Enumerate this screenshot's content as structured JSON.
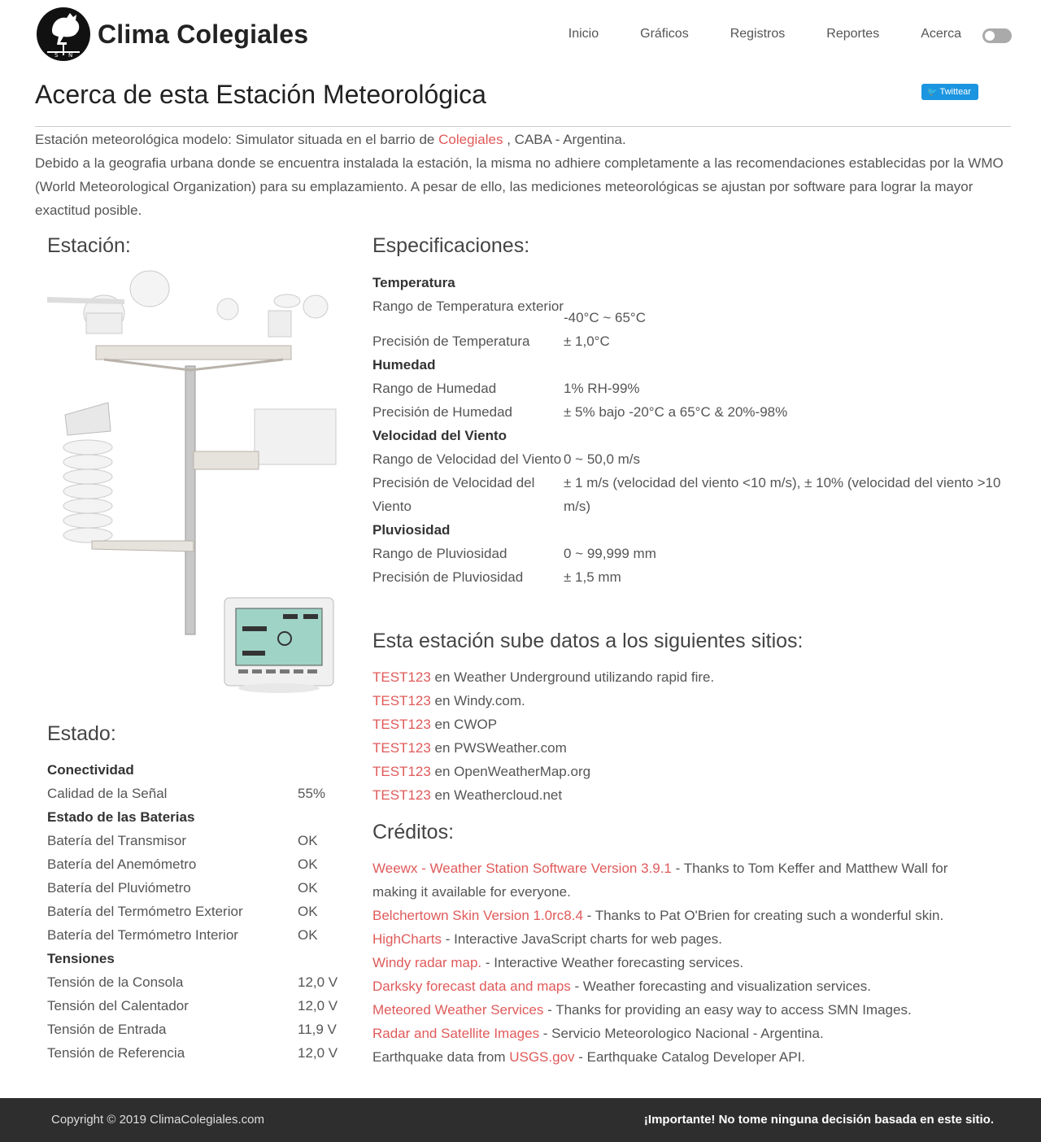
{
  "header": {
    "brand": "Clima Colegiales",
    "nav": [
      "Inicio",
      "Gráficos",
      "Registros",
      "Reportes",
      "Acerca"
    ]
  },
  "page": {
    "title": "Acerca de esta Estación Meteorológica",
    "tweet_label": "Twittear",
    "intro_a": "Estación meteorológica modelo: Simulator situada en el barrio de ",
    "intro_link": "Colegiales",
    "intro_b": " , CABA - Argentina.",
    "intro_c": "Debido a la geografia urbana donde se encuentra instalada la estación, la misma no adhiere completamente a las recomendaciones establecidas por la WMO (World Meteorological Organization) para su emplazamiento. A pesar de ello, las mediciones meteorológicas se ajustan por software para lograr la mayor exactitud posible."
  },
  "station": {
    "heading": "Estación:"
  },
  "status": {
    "heading": "Estado:",
    "rows": [
      {
        "k": "Conectividad",
        "v": "",
        "head": true
      },
      {
        "k": "Calidad de la Señal",
        "v": "55%"
      },
      {
        "k": "Estado de las Baterias",
        "v": "",
        "head": true
      },
      {
        "k": "Batería del Transmisor",
        "v": "OK"
      },
      {
        "k": "Batería del Anemómetro",
        "v": "OK"
      },
      {
        "k": "Batería del Pluviómetro",
        "v": "OK"
      },
      {
        "k": "Batería del Termómetro Exterior",
        "v": "OK"
      },
      {
        "k": "Batería del Termómetro Interior",
        "v": "OK"
      },
      {
        "k": "Tensiones",
        "v": "",
        "head": true
      },
      {
        "k": "Tensión de la Consola",
        "v": "12,0 V"
      },
      {
        "k": "Tensión del Calentador",
        "v": "12,0 V"
      },
      {
        "k": "Tensión de Entrada",
        "v": "11,9 V"
      },
      {
        "k": "Tensión de Referencia",
        "v": "12,0 V"
      }
    ]
  },
  "specs": {
    "heading": "Especificaciones:",
    "rows": [
      {
        "k": "Temperatura",
        "v": "",
        "head": true
      },
      {
        "k": "Rango de Temperatura exterior",
        "v": "-40°C ~ 65°C",
        "twoline": true
      },
      {
        "k": "Precisión de Temperatura",
        "v": "± 1,0°C"
      },
      {
        "k": "Humedad",
        "v": "",
        "head": true
      },
      {
        "k": "Rango de Humedad",
        "v": "1% RH-99%"
      },
      {
        "k": "Precisión de Humedad",
        "v": "± 5% bajo -20°C a 65°C & 20%-98%"
      },
      {
        "k": "Velocidad del Viento",
        "v": "",
        "head": true
      },
      {
        "k": "Rango de Velocidad del Viento",
        "v": "0 ~ 50,0 m/s"
      },
      {
        "k": "Precisión de Velocidad del Viento",
        "v": "± 1 m/s (velocidad del viento <10 m/s), ± 10% (velocidad del viento >10 m/s)"
      },
      {
        "k": "Pluviosidad",
        "v": "",
        "head": true
      },
      {
        "k": "Rango de Pluviosidad",
        "v": "0 ~ 99,999 mm"
      },
      {
        "k": "Precisión de Pluviosidad",
        "v": "± 1,5 mm"
      }
    ]
  },
  "uploads": {
    "heading": "Esta estación sube datos a los siguientes sitios:",
    "items": [
      {
        "link": "TEST123",
        "text": " en Weather Underground utilizando rapid fire."
      },
      {
        "link": "TEST123",
        "text": " en Windy.com."
      },
      {
        "link": "TEST123",
        "text": " en CWOP"
      },
      {
        "link": "TEST123",
        "text": " en PWSWeather.com"
      },
      {
        "link": "TEST123",
        "text": " en OpenWeatherMap.org"
      },
      {
        "link": "TEST123",
        "text": " en Weathercloud.net"
      }
    ]
  },
  "credits": {
    "heading": "Créditos:",
    "items": [
      {
        "pre": "",
        "link": "Weewx - Weather Station Software Version 3.9.1",
        "text": " - Thanks to Tom Keffer and Matthew Wall for making it available for everyone."
      },
      {
        "pre": "",
        "link": "Belchertown Skin Version 1.0rc8.4",
        "text": " - Thanks to Pat O'Brien for creating such a wonderful skin."
      },
      {
        "pre": "",
        "link": "HighCharts",
        "text": " - Interactive JavaScript charts for web pages."
      },
      {
        "pre": "",
        "link": "Windy radar map.",
        "text": " - Interactive Weather forecasting services."
      },
      {
        "pre": "",
        "link": "Darksky forecast data and maps",
        "text": " - Weather forecasting and visualization services."
      },
      {
        "pre": "",
        "link": "Meteored Weather Services",
        "text": " - Thanks for providing an easy way to access SMN Images."
      },
      {
        "pre": "",
        "link": "Radar and Satellite Images",
        "text": " - Servicio Meteorologico Nacional - Argentina."
      },
      {
        "pre": "Earthquake data from ",
        "link": "USGS.gov",
        "text": " - Earthquake Catalog Developer API."
      }
    ]
  },
  "footer": {
    "copyright": "Copyright © 2019 ClimaColegiales.com",
    "warning": "¡Importante! No tome ninguna decisión basada en este sitio."
  },
  "icons": {
    "logo": "rooster-weathervane-logo",
    "tweet": "twitter-bird-icon",
    "theme": "dark-mode-toggle"
  },
  "colors": {
    "link": "#e05a5a",
    "tweet": "#1b95e0",
    "footer": "#2e2e2e"
  }
}
